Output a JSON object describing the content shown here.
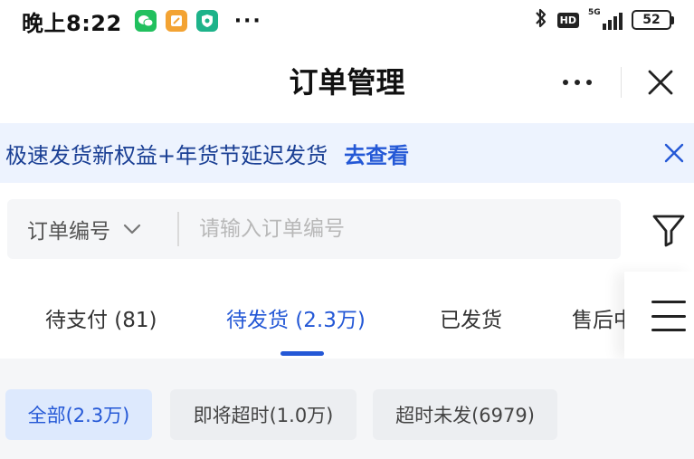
{
  "status_bar": {
    "time": "晚上8:22",
    "app_icons": [
      "wechat-icon",
      "notes-icon",
      "shield-icon"
    ],
    "more": "···",
    "hd": "HD",
    "network": "5G",
    "battery": "52"
  },
  "header": {
    "title": "订单管理"
  },
  "banner": {
    "text": "极速发货新权益+年货节延迟发货",
    "link": "去查看"
  },
  "search": {
    "type_label": "订单编号",
    "placeholder": "请输入订单编号",
    "value": ""
  },
  "tabs": [
    {
      "label": "待支付 (81)",
      "active": false
    },
    {
      "label": "待发货 (2.3万)",
      "active": true
    },
    {
      "label": "已发货",
      "active": false
    },
    {
      "label": "售后中",
      "active": false
    }
  ],
  "sub_filters": [
    {
      "label": "全部(2.3万)",
      "active": true
    },
    {
      "label": "即将超时(1.0万)",
      "active": false
    },
    {
      "label": "超时未发(6979)",
      "active": false
    }
  ],
  "colors": {
    "accent": "#2458d6",
    "banner_bg": "#edf3fe",
    "wechat": "#21c05e"
  }
}
